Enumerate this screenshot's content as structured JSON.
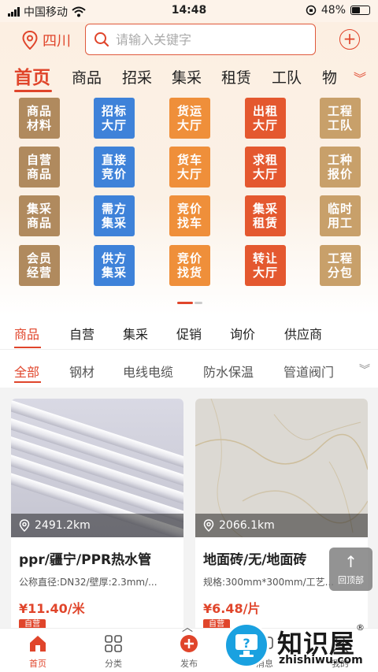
{
  "status_bar": {
    "carrier": "中国移动",
    "time": "14:48",
    "battery": "48%"
  },
  "header": {
    "location": "四川",
    "search_placeholder": "请输入关键字",
    "nav": [
      "首页",
      "商品",
      "招采",
      "集采",
      "租赁",
      "工队",
      "物"
    ]
  },
  "grid": [
    [
      "商品",
      "材料"
    ],
    [
      "招标",
      "大厅"
    ],
    [
      "货运",
      "大厅"
    ],
    [
      "出租",
      "大厅"
    ],
    [
      "工程",
      "工队"
    ],
    [
      "自营",
      "商品"
    ],
    [
      "直接",
      "竞价"
    ],
    [
      "货车",
      "大厅"
    ],
    [
      "求租",
      "大厅"
    ],
    [
      "工种",
      "报价"
    ],
    [
      "集采",
      "商品"
    ],
    [
      "需方",
      "集采"
    ],
    [
      "竞价",
      "找车"
    ],
    [
      "集采",
      "租赁"
    ],
    [
      "临时",
      "用工"
    ],
    [
      "会员",
      "经营"
    ],
    [
      "供方",
      "集采"
    ],
    [
      "竞价",
      "找货"
    ],
    [
      "转让",
      "大厅"
    ],
    [
      "工程",
      "分包"
    ]
  ],
  "tile_colors": [
    "#b08a5e",
    "#3e82d9",
    "#ef8f3a",
    "#e4582f",
    "#c8a06a"
  ],
  "category_tabs": [
    "商品",
    "自营",
    "集采",
    "促销",
    "询价",
    "供应商"
  ],
  "sub_tabs": [
    "全部",
    "钢材",
    "电线电缆",
    "防水保温",
    "管道阀门"
  ],
  "products": [
    {
      "distance": "2491.2km",
      "title": "ppr/疆宁/PPR热水管",
      "spec": "公称直径:DN32/壁厚:2.3mm/...",
      "price": "¥11.40/米",
      "tag": "自营"
    },
    {
      "distance": "2066.1km",
      "title": "地面砖/无/地面砖",
      "spec": "规格:300mm*300mm/工艺...",
      "price": "¥6.48/片",
      "tag": "自营"
    }
  ],
  "back_to_top": "回顶部",
  "tabbar": [
    "首页",
    "分类",
    "发布",
    "消息",
    "我的"
  ],
  "watermark": {
    "cn": "知识屋",
    "en": "zhishiwu.com",
    "reg": "®"
  },
  "colors": {
    "accent": "#e0452b"
  }
}
